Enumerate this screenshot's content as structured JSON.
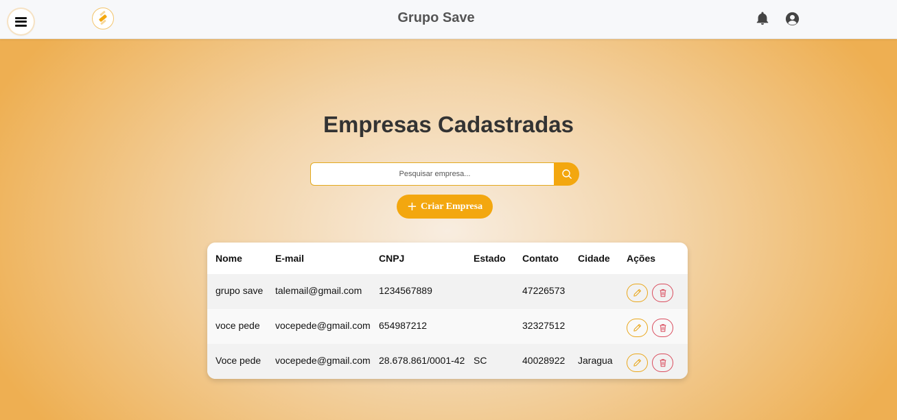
{
  "header": {
    "title": "Grupo Save"
  },
  "icons": {
    "menu": "hamburger-menu-icon",
    "logo": "save-logo",
    "bell": "bell-icon",
    "user": "user-circle-icon",
    "search": "search-icon",
    "plus": "plus-icon",
    "edit": "pencil-icon",
    "delete": "trash-icon"
  },
  "colors": {
    "accent": "#f3a70f",
    "danger": "#d94b5c",
    "background_edge": "#eeaf52"
  },
  "page": {
    "title": "Empresas Cadastradas",
    "search_placeholder": "Pesquisar empresa...",
    "create_label": "Criar Empresa",
    "create_plus": "+"
  },
  "table": {
    "headers": [
      "Nome",
      "E-mail",
      "CNPJ",
      "Estado",
      "Contato",
      "Cidade",
      "Ações"
    ],
    "rows": [
      {
        "nome": "grupo save",
        "email": "talemail@gmail.com",
        "cnpj": "1234567889",
        "estado": "",
        "contato": "47226573",
        "cidade": ""
      },
      {
        "nome": "voce pede",
        "email": "vocepede@gmail.com",
        "cnpj": "654987212",
        "estado": "",
        "contato": "32327512",
        "cidade": ""
      },
      {
        "nome": "Voce pede",
        "email": "vocepede@gmail.com",
        "cnpj": "28.678.861/0001-42",
        "estado": "SC",
        "contato": "40028922",
        "cidade": "Jaragua"
      }
    ]
  }
}
